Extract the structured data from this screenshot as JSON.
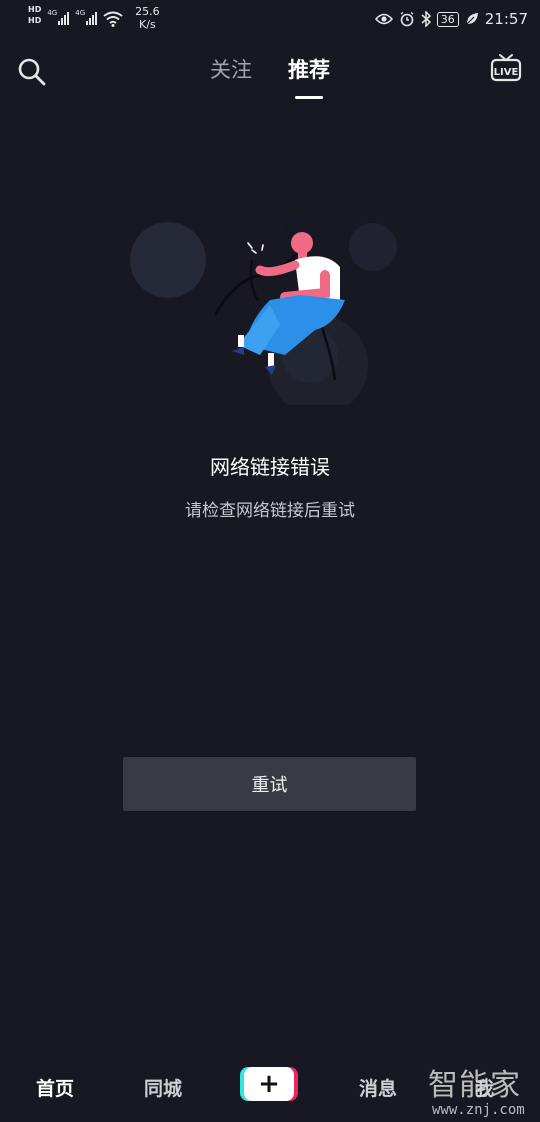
{
  "status_bar": {
    "hd_badge_1": "HD",
    "hd_badge_2": "HD",
    "net_1": "4G",
    "net_2": "4G",
    "speed_value": "25.6",
    "speed_unit": "K/s",
    "battery": "36",
    "time": "21:57",
    "icons": [
      "hd-icon",
      "signal-icon",
      "wifi-icon",
      "eye-icon",
      "alarm-icon",
      "bluetooth-icon",
      "battery-icon",
      "leaf-icon"
    ]
  },
  "top_nav": {
    "tabs": [
      {
        "label": "关注",
        "active": false
      },
      {
        "label": "推荐",
        "active": true
      }
    ],
    "live_label": "LIVE"
  },
  "error": {
    "title": "网络链接错误",
    "subtitle": "请检查网络链接后重试",
    "retry_label": "重试"
  },
  "bottom_nav": {
    "items": [
      {
        "label": "首页",
        "active": true
      },
      {
        "label": "同城",
        "active": false
      },
      {
        "label": "+",
        "active": false
      },
      {
        "label": "消息",
        "active": false
      },
      {
        "label": "我",
        "active": false
      }
    ]
  },
  "watermark": {
    "text": "智能家",
    "url": "www.znj.com"
  },
  "colors": {
    "background": "#171822",
    "accent_pink": "#f0245f",
    "accent_cyan": "#2ee6e0",
    "button_bg": "#3a3a44"
  }
}
